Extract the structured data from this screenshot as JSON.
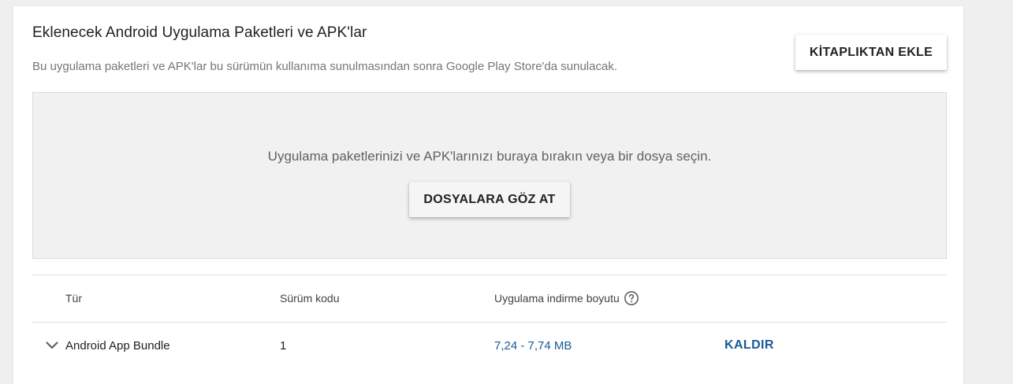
{
  "section": {
    "title": "Eklenecek Android Uygulama Paketleri ve APK'lar",
    "description": "Bu uygulama paketleri ve APK'lar bu sürümün kullanıma sunulmasından sonra Google Play Store'da sunulacak.",
    "add_from_library_label": "KİTAPLIKTAN EKLE"
  },
  "dropzone": {
    "instruction": "Uygulama paketlerinizi ve APK'larınızı buraya bırakın veya bir dosya seçin.",
    "browse_label": "DOSYALARA GÖZ AT"
  },
  "table": {
    "headers": {
      "type": "Tür",
      "version_code": "Sürüm kodu",
      "download_size": "Uygulama indirme boyutu"
    },
    "rows": [
      {
        "type": "Android App Bundle",
        "version_code": "1",
        "download_size": "7,24 - 7,74 MB",
        "remove_label": "KALDIR"
      }
    ]
  },
  "icons": {
    "help": "help-circle-icon",
    "expand": "chevron-down-icon"
  },
  "colors": {
    "background": "#efefef",
    "card": "#ffffff",
    "dropzone": "#f1f1f1",
    "link": "#1a5a96",
    "text_primary": "#212121",
    "text_secondary": "#757575"
  }
}
